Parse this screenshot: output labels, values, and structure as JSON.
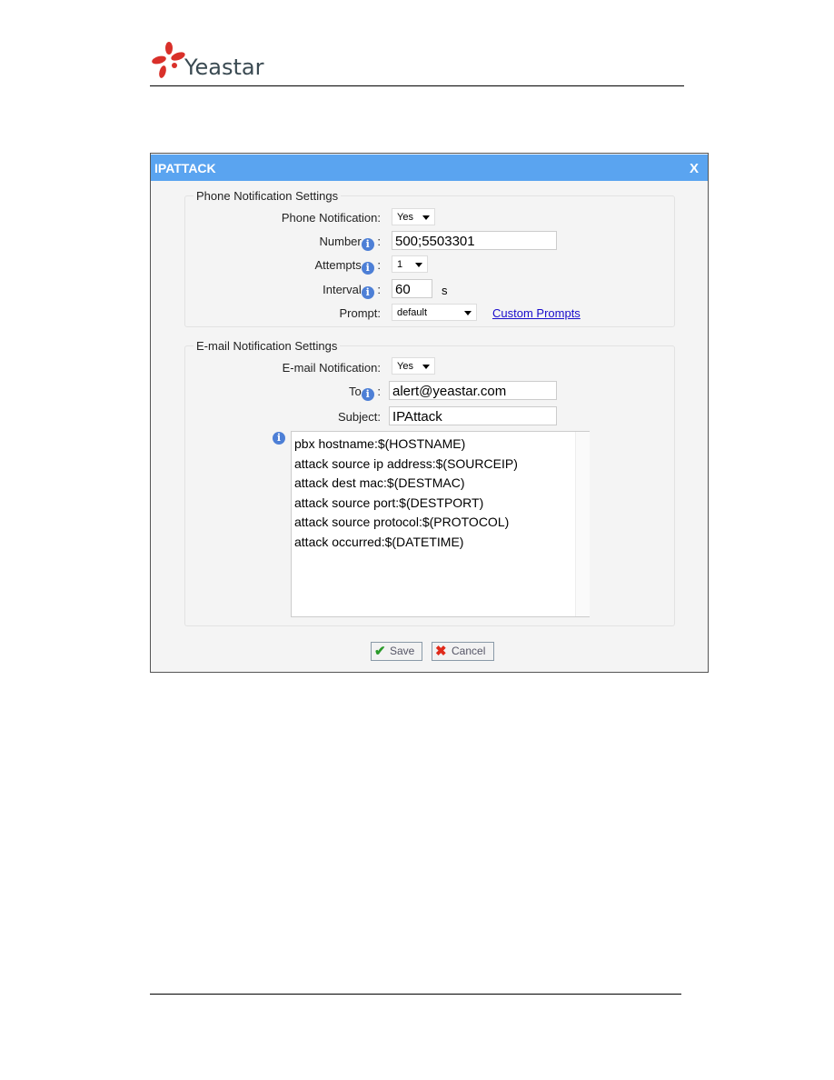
{
  "header": {
    "logo_text": "Yeastar",
    "brand_color": "#d9302a"
  },
  "dialog": {
    "title": "IPATTACK",
    "close_label": "X",
    "titlebar_color": "#5aa4f0",
    "phone": {
      "legend": "Phone Notification Settings",
      "notification_label": "Phone Notification:",
      "notification_value": "Yes",
      "number_label": "Number",
      "number_value": "500;5503301",
      "attempts_label": "Attempts",
      "attempts_value": "1",
      "interval_label": "Interval",
      "interval_value": "60",
      "interval_unit": "s",
      "prompt_label": "Prompt:",
      "prompt_value": "default",
      "custom_prompts_link": "Custom Prompts"
    },
    "email": {
      "legend": "E-mail Notification Settings",
      "notification_label": "E-mail Notification:",
      "notification_value": "Yes",
      "to_label": "To",
      "to_value": "alert@yeastar.com",
      "subject_label": "Subject:",
      "subject_value": "IPAttack",
      "body": "pbx hostname:$(HOSTNAME)\nattack source ip address:$(SOURCEIP)\nattack dest mac:$(DESTMAC)\nattack source port:$(DESTPORT)\nattack source protocol:$(PROTOCOL)\nattack occurred:$(DATETIME)"
    },
    "save_label": "Save",
    "cancel_label": "Cancel",
    "colon": ":"
  }
}
